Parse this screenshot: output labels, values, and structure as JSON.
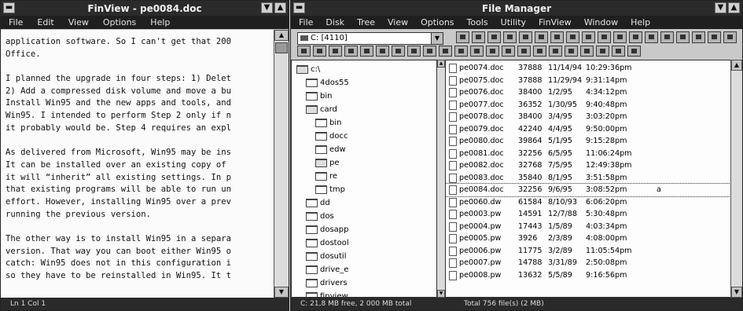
{
  "viewer": {
    "title": "FinView - pe0084.doc",
    "menu": [
      "File",
      "Edit",
      "View",
      "Options",
      "Help"
    ],
    "lines": [
      "application software. So I can't get that 200",
      "Office.",
      "",
      "I planned the upgrade in four steps: 1) Delet",
      "2) Add a compressed disk volume and move a bu",
      "Install Win95 and the new apps and tools, and",
      "Win95. I intended to perform Step 2 only if n",
      "it probably would be. Step 4 requires an expl",
      "",
      "As delivered from Microsoft, Win95 may be ins",
      "It can be installed over an existing copy of",
      "it will “inherit” all existing settings. In p",
      "that existing programs will be able to run un",
      "effort. However, installing Win95 over a prev",
      "running the previous version.",
      "",
      "The other way is to install Win95 in a separa",
      "version. That way you can boot either Win95 o",
      "catch: Win95 does not in this configuration i",
      "so they have to be reinstalled in Win95. It t"
    ],
    "status": "Ln 1  Col 1"
  },
  "fm": {
    "title": "File Manager",
    "menu": [
      "File",
      "Disk",
      "Tree",
      "View",
      "Options",
      "Tools",
      "Utility",
      "FinView",
      "Window",
      "Help"
    ],
    "drive_label": "C: [4110]",
    "status_left": "C: 21,8 MB free, 2 000 MB total",
    "status_right": "Total 756 file(s) (2 MB)",
    "tree": [
      {
        "name": "c:\\",
        "depth": 0,
        "open": true
      },
      {
        "name": "4dos55",
        "depth": 1
      },
      {
        "name": "bin",
        "depth": 1
      },
      {
        "name": "card",
        "depth": 1,
        "open": true
      },
      {
        "name": "bin",
        "depth": 2
      },
      {
        "name": "docc",
        "depth": 2
      },
      {
        "name": "edw",
        "depth": 2
      },
      {
        "name": "pe",
        "depth": 2,
        "open": true
      },
      {
        "name": "re",
        "depth": 2
      },
      {
        "name": "tmp",
        "depth": 2
      },
      {
        "name": "dd",
        "depth": 1
      },
      {
        "name": "dos",
        "depth": 1
      },
      {
        "name": "dosapp",
        "depth": 1
      },
      {
        "name": "dostool",
        "depth": 1
      },
      {
        "name": "dosutil",
        "depth": 1
      },
      {
        "name": "drive_e",
        "depth": 1
      },
      {
        "name": "drivers",
        "depth": 1
      },
      {
        "name": "finview",
        "depth": 1
      }
    ],
    "files": [
      {
        "name": "pe0074.doc",
        "size": "37888",
        "date": "11/14/94",
        "time": "10:29:36pm",
        "attr": ""
      },
      {
        "name": "pe0075.doc",
        "size": "37888",
        "date": "11/29/94",
        "time": "9:31:14pm",
        "attr": ""
      },
      {
        "name": "pe0076.doc",
        "size": "38400",
        "date": "1/2/95",
        "time": "4:34:12pm",
        "attr": ""
      },
      {
        "name": "pe0077.doc",
        "size": "36352",
        "date": "1/30/95",
        "time": "9:40:48pm",
        "attr": ""
      },
      {
        "name": "pe0078.doc",
        "size": "38400",
        "date": "3/4/95",
        "time": "3:03:20pm",
        "attr": ""
      },
      {
        "name": "pe0079.doc",
        "size": "42240",
        "date": "4/4/95",
        "time": "9:50:00pm",
        "attr": ""
      },
      {
        "name": "pe0080.doc",
        "size": "39864",
        "date": "5/1/95",
        "time": "9:15:28pm",
        "attr": ""
      },
      {
        "name": "pe0081.doc",
        "size": "32256",
        "date": "6/5/95",
        "time": "11:06:24pm",
        "attr": ""
      },
      {
        "name": "pe0082.doc",
        "size": "32768",
        "date": "7/5/95",
        "time": "12:49:38pm",
        "attr": ""
      },
      {
        "name": "pe0083.doc",
        "size": "35840",
        "date": "8/1/95",
        "time": "3:51:58pm",
        "attr": ""
      },
      {
        "name": "pe0084.doc",
        "size": "32256",
        "date": "9/6/95",
        "time": "3:08:52pm",
        "attr": "a"
      },
      {
        "name": "pe0060.dw",
        "size": "61584",
        "date": "8/10/93",
        "time": "6:06:20pm",
        "attr": ""
      },
      {
        "name": "pe0003.pw",
        "size": "14591",
        "date": "12/7/88",
        "time": "5:30:48pm",
        "attr": ""
      },
      {
        "name": "pe0004.pw",
        "size": "17443",
        "date": "1/5/89",
        "time": "4:03:34pm",
        "attr": ""
      },
      {
        "name": "pe0005.pw",
        "size": "3926",
        "date": "2/3/89",
        "time": "4:08:00pm",
        "attr": ""
      },
      {
        "name": "pe0006.pw",
        "size": "11775",
        "date": "3/2/89",
        "time": "11:05:54pm",
        "attr": ""
      },
      {
        "name": "pe0007.pw",
        "size": "14788",
        "date": "3/31/89",
        "time": "2:50:08pm",
        "attr": ""
      },
      {
        "name": "pe0008.pw",
        "size": "13632",
        "date": "5/5/89",
        "time": "9:16:56pm",
        "attr": ""
      }
    ]
  }
}
